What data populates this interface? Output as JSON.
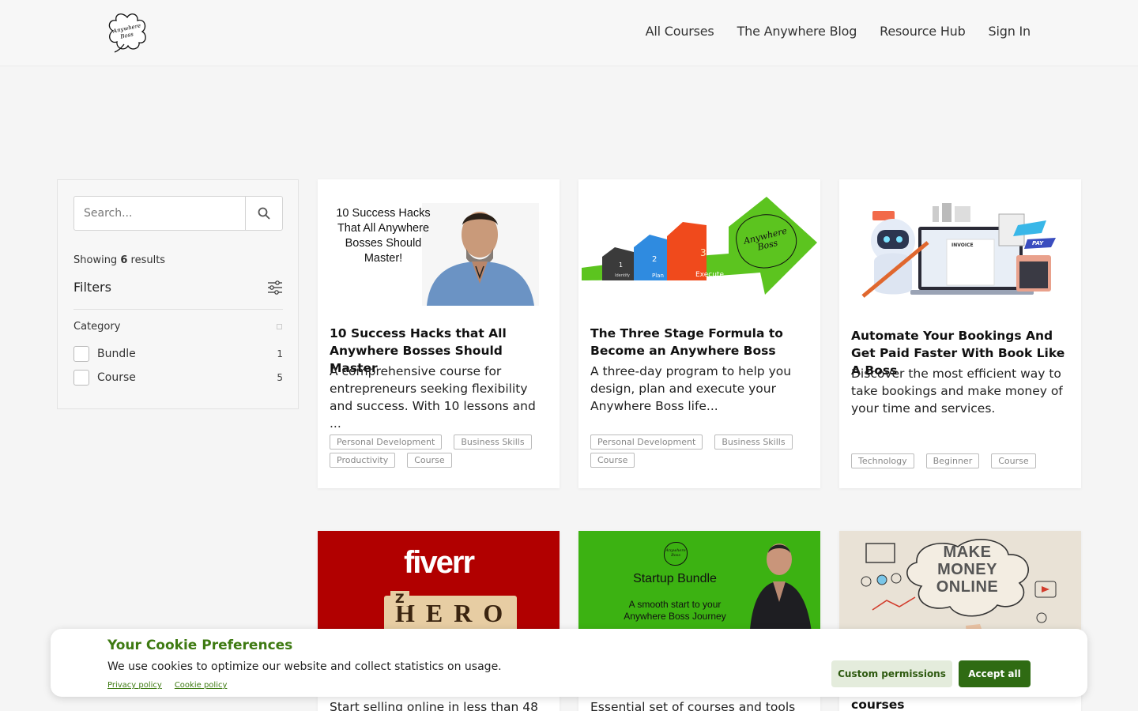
{
  "header": {
    "logo_text": "Anywhere Boss",
    "nav": [
      {
        "label": "All Courses"
      },
      {
        "label": "The Anywhere Blog"
      },
      {
        "label": "Resource Hub"
      },
      {
        "label": "Sign In"
      }
    ]
  },
  "sidebar": {
    "search_placeholder": "Search...",
    "showing_prefix": "Showing",
    "showing_count": "6",
    "showing_suffix": "results",
    "filters_label": "Filters",
    "category_label": "Category",
    "options": [
      {
        "label": "Bundle",
        "count": "1"
      },
      {
        "label": "Course",
        "count": "5"
      }
    ]
  },
  "cards": [
    {
      "image_text": "10 Success Hacks That All Anywhere Bosses Should Master!",
      "title": "10 Success Hacks that All Anywhere Bosses Should Master",
      "description": "A comprehensive course for entrepreneurs seeking flexibility and success. With 10 lessons and ...",
      "tags": [
        "Personal Development",
        "Business Skills",
        "Productivity",
        "Course"
      ]
    },
    {
      "image_steps": [
        "1",
        "2",
        "3"
      ],
      "image_step_labels": [
        "Identify",
        "Plan",
        "Execute"
      ],
      "image_logo_text": "Anywhere Boss",
      "title": "The Three Stage Formula to Become an Anywhere Boss",
      "description": "A three-day program to help you design, plan and execute your Anywhere Boss life...",
      "tags": [
        "Personal Development",
        "Business Skills",
        "Course"
      ]
    },
    {
      "image_invoice_label": "INVOICE",
      "image_pay_label": "PAY",
      "title": "Automate Your Bookings And Get Paid Faster With Book Like A Boss",
      "description": "Discover the most efficient way to take bookings and make money of your time and services.",
      "tags": [
        "Technology",
        "Beginner",
        "Course"
      ]
    },
    {
      "image_brand": "fiverr",
      "image_word": "HERO",
      "image_flip_letter": "Z",
      "description_partial": "Start selling online in less than 48"
    },
    {
      "image_logo_text": "Anywhere Boss",
      "image_title": "Startup Bundle",
      "image_subtitle": "A smooth start to your Anywhere Boss Journey",
      "description_partial": "Essential set of courses and tools to"
    },
    {
      "image_text": "MAKE MONEY ONLINE",
      "title_partial": "courses"
    }
  ],
  "cookie": {
    "title": "Your Cookie Preferences",
    "text": "We use cookies to optimize our website and collect statistics on usage.",
    "privacy_link": "Privacy policy",
    "cookie_link": "Cookie policy",
    "custom_button": "Custom permissions",
    "accept_button": "Accept all"
  },
  "colors": {
    "background": "#f5f5f5",
    "accent_green": "#2f6b13",
    "fiverr_red": "#b10000",
    "bundle_green": "#3cb212"
  }
}
